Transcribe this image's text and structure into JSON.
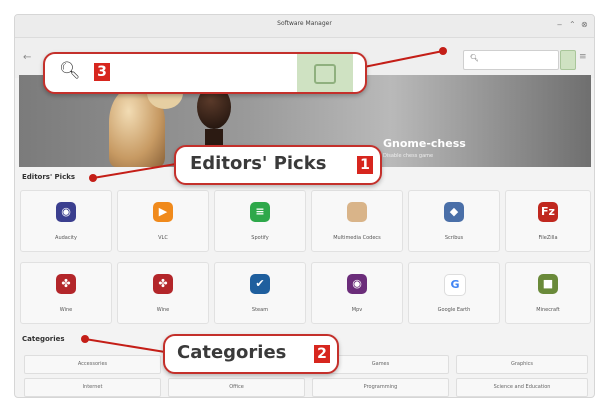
{
  "window": {
    "title": "Software Manager"
  },
  "search": {
    "placeholder": ""
  },
  "banner": {
    "title": "Gnome-chess",
    "subtitle": "Disable chess game"
  },
  "sections": {
    "editors_picks": "Editors' Picks",
    "categories": "Categories"
  },
  "apps": [
    {
      "name": "Audacity",
      "icon": "audacity-icon",
      "color": "#3b3f8f",
      "glyph": "◉"
    },
    {
      "name": "VLC",
      "icon": "vlc-icon",
      "color": "#f08a1c",
      "glyph": "▶"
    },
    {
      "name": "Spotify",
      "icon": "spotify-icon",
      "color": "#2ea84a",
      "glyph": "≡"
    },
    {
      "name": "Multimedia Codecs",
      "icon": "codecs-icon",
      "color": "#d9b489",
      "glyph": ""
    },
    {
      "name": "Scribus",
      "icon": "scribus-icon",
      "color": "#4a6fa8",
      "glyph": "◆"
    },
    {
      "name": "FileZilla",
      "icon": "filezilla-icon",
      "color": "#c0281f",
      "glyph": "Fz"
    },
    {
      "name": "Wine",
      "icon": "wine-icon",
      "color": "#b3262a",
      "glyph": "✤"
    },
    {
      "name": "Wine",
      "icon": "wine-icon",
      "color": "#b3262a",
      "glyph": "✤"
    },
    {
      "name": "Steam",
      "icon": "steam-icon",
      "color": "#1f5f9e",
      "glyph": "✔"
    },
    {
      "name": "Mpv",
      "icon": "mpv-icon",
      "color": "#6b2d7a",
      "glyph": "◉"
    },
    {
      "name": "Google Earth",
      "icon": "google-icon",
      "color": "#ffffff",
      "glyph": "G"
    },
    {
      "name": "Minecraft",
      "icon": "minecraft-icon",
      "color": "#6a8a3a",
      "glyph": "■"
    }
  ],
  "categories": [
    {
      "label": "Accessories"
    },
    {
      "label": ""
    },
    {
      "label": "Games"
    },
    {
      "label": "Graphics"
    },
    {
      "label": "Internet"
    },
    {
      "label": "Office"
    },
    {
      "label": "Programming"
    },
    {
      "label": "Science and Education"
    }
  ],
  "callouts": [
    {
      "label": "",
      "number": "3"
    },
    {
      "label": "Editors' Picks",
      "number": "1"
    },
    {
      "label": "Categories",
      "number": "2"
    }
  ],
  "colors": {
    "accent_red": "#d7261e",
    "search_green": "#cfe2c2"
  }
}
